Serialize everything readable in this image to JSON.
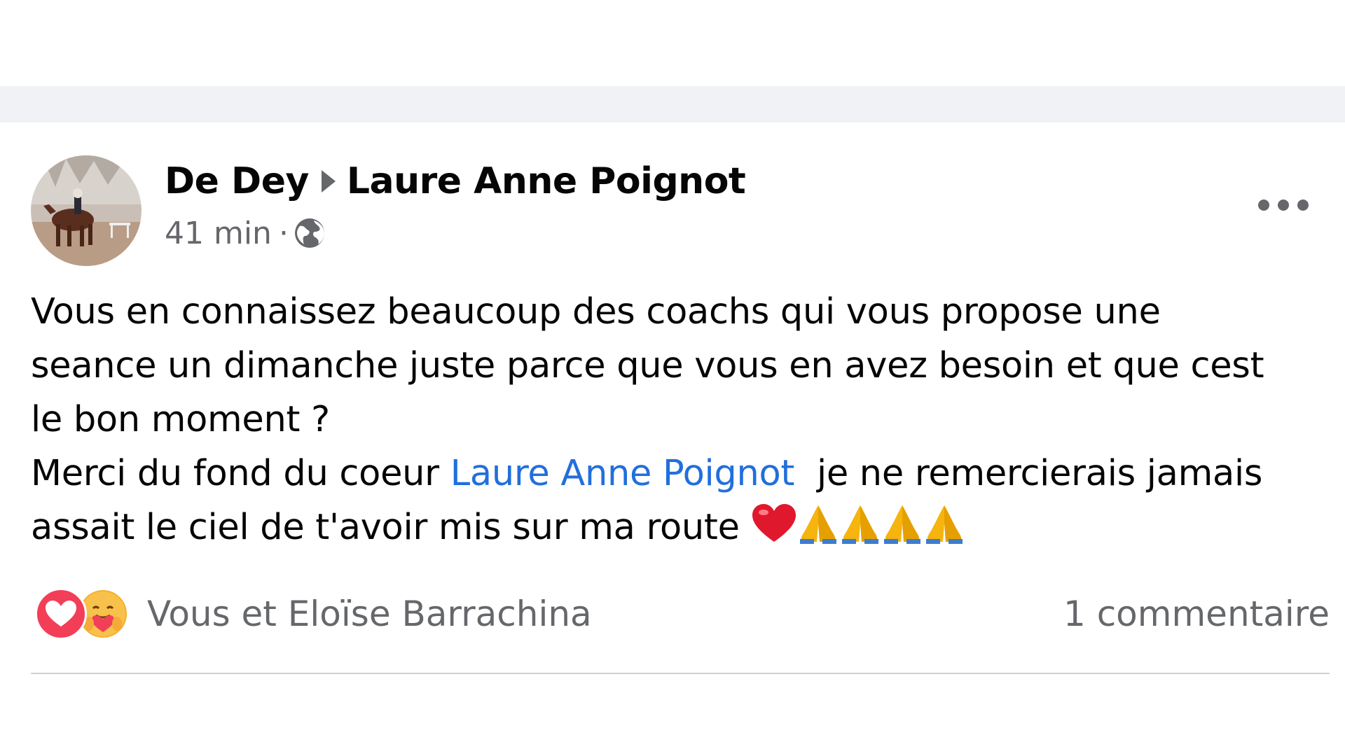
{
  "post": {
    "author": "De Dey",
    "recipient": "Laure Anne Poignot",
    "timestamp": "41 min",
    "separator": "·",
    "privacy_icon": "globe-icon",
    "more_icon": "more-options-icon",
    "text": {
      "line1": "Vous en connaissez beaucoup des coachs qui vous propose une",
      "line2": "seance un dimanche juste parce que vous en avez besoin et que cest",
      "line3": "le bon moment ?",
      "line4_prefix": "Merci du fond du coeur ",
      "line4_mention": "Laure Anne Poignot",
      "line4_suffix": "  je ne remercierais jamais",
      "line5": "assait le ciel de t'avoir mis sur ma route",
      "emojis": [
        "red-heart",
        "folded-hands",
        "folded-hands",
        "folded-hands",
        "folded-hands"
      ]
    }
  },
  "reactions": {
    "icons": [
      "love-reaction",
      "care-reaction"
    ],
    "summary": "Vous et Eloïse Barrachina"
  },
  "comments": {
    "count_label": "1 commentaire"
  },
  "colors": {
    "feed_background": "#f0f2f5",
    "primary_text": "#050505",
    "secondary_text": "#65676b",
    "mention_link": "#216fdb",
    "love_red": "#f33e58",
    "care_yellow": "#f7b125",
    "divider": "#ced0d4"
  }
}
